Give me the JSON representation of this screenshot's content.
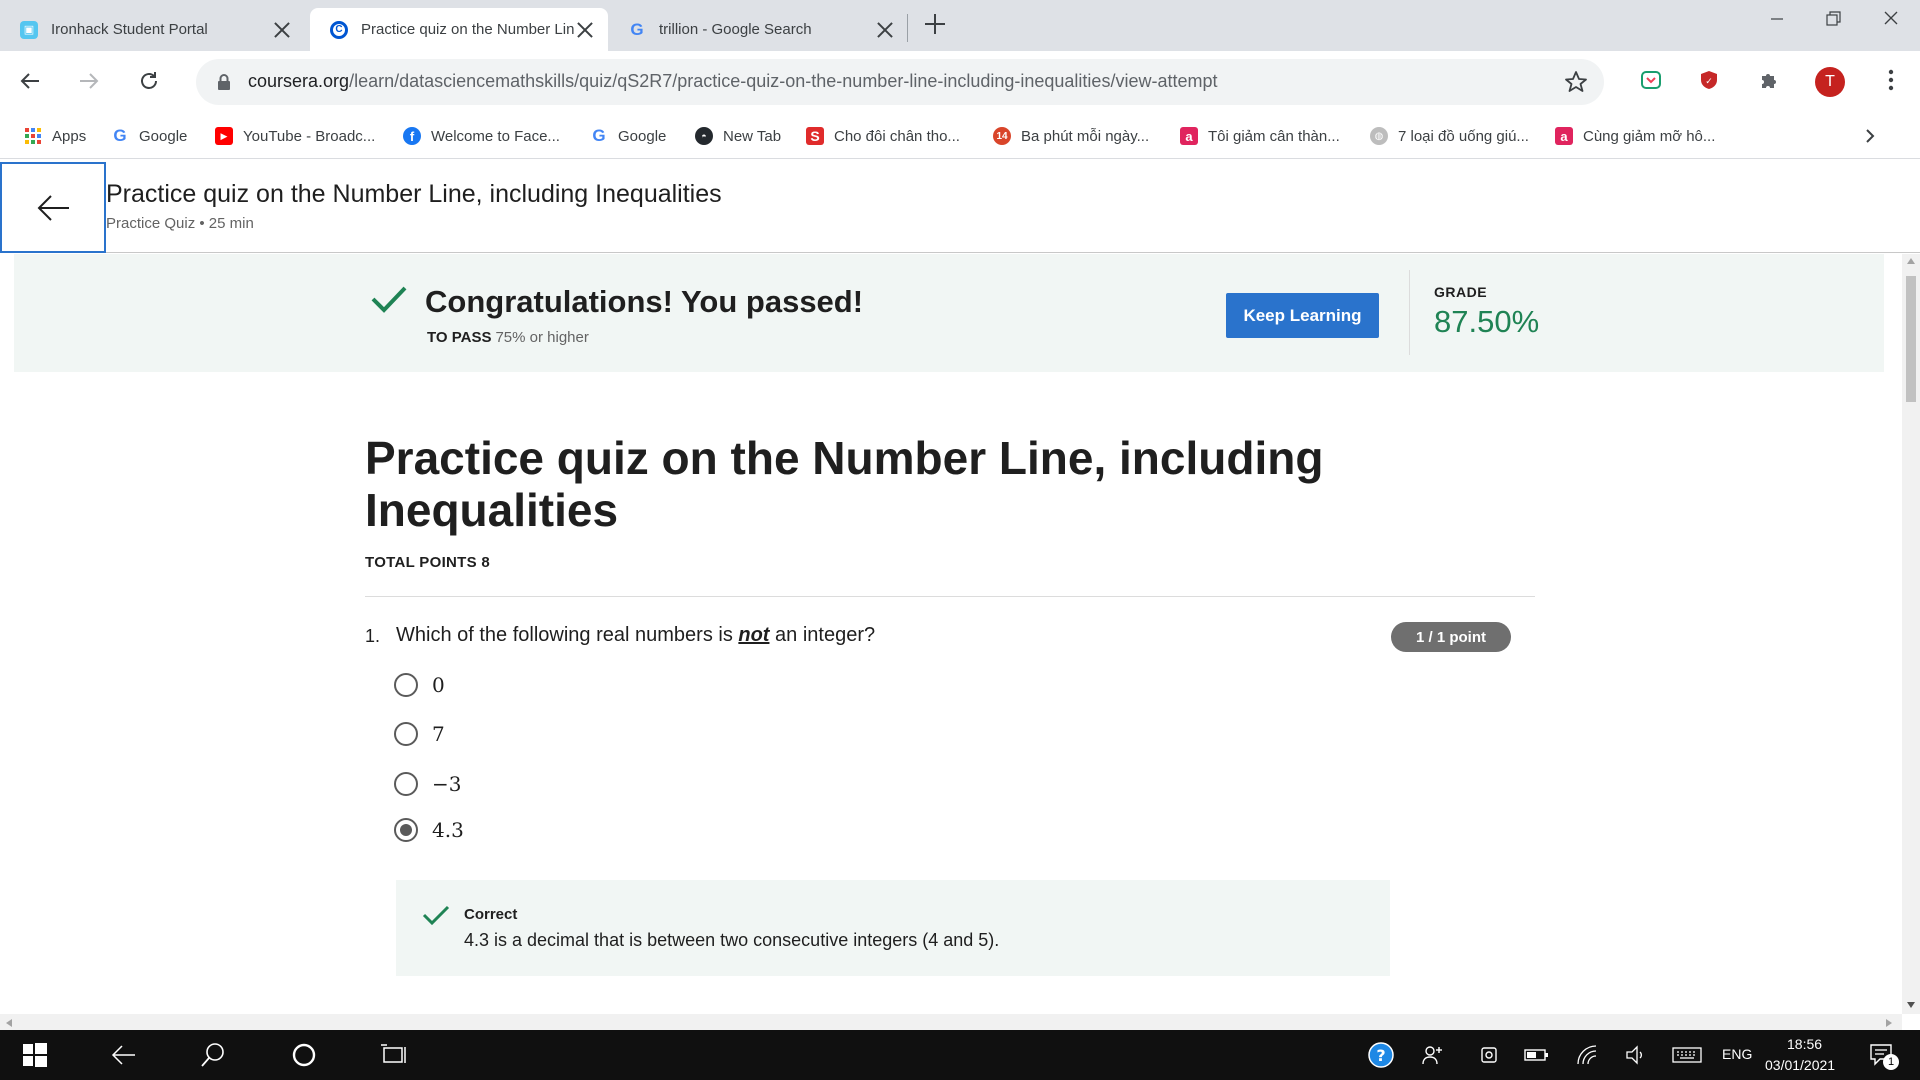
{
  "browser": {
    "tabs": [
      {
        "label": "Ironhack Student Portal",
        "active": false
      },
      {
        "label": "Practice quiz on the Number Line, including Inequalities",
        "active": true
      },
      {
        "label": "trillion - Google Search",
        "active": false
      }
    ],
    "url_host": "coursera.org",
    "url_path": "/learn/datasciencemathskills/quiz/qS2R7/practice-quiz-on-the-number-line-including-inequalities/view-attempt",
    "profile_initial": "T",
    "bookmarks": [
      {
        "label": "Apps",
        "icon": "apps-grid-icon"
      },
      {
        "label": "Google",
        "icon": "google-icon"
      },
      {
        "label": "YouTube - Broadc...",
        "icon": "youtube-icon"
      },
      {
        "label": "Welcome to Face...",
        "icon": "facebook-icon"
      },
      {
        "label": "Google",
        "icon": "google-icon"
      },
      {
        "label": "New Tab",
        "icon": "github-icon"
      },
      {
        "label": "Cho đôi chân thо...",
        "icon": "s-icon"
      },
      {
        "label": "Ba phút mỗi ngày...",
        "icon": "14-icon"
      },
      {
        "label": "Tôi giảm cân thàn...",
        "icon": "a-icon"
      },
      {
        "label": "7 loại đồ uống giú...",
        "icon": "globe-icon"
      },
      {
        "label": "Cùng giảm mỡ hô...",
        "icon": "a-icon"
      }
    ]
  },
  "course_header": {
    "title": "Practice quiz on the Number Line, including Inequalities",
    "subtitle": "Practice Quiz • 25 min"
  },
  "result": {
    "message": "Congratulations! You passed!",
    "to_pass_label": "TO PASS",
    "to_pass_value": "75% or higher",
    "keep_learning": "Keep Learning",
    "grade_label": "GRADE",
    "grade_value": "87.50%"
  },
  "quiz": {
    "title": "Practice quiz on the Number Line, including Inequalities",
    "total_points": "TOTAL POINTS 8",
    "questions": [
      {
        "number": "1.",
        "text_before": "Which of the following real numbers is ",
        "text_emph": "not",
        "text_after": " an integer?",
        "points": "1 / 1 point",
        "options": [
          "0",
          "7",
          "−3",
          "4.3"
        ],
        "selected_index": 3,
        "feedback_label": "Correct",
        "feedback_text": "4.3 is a decimal that is between two consecutive integers (4 and 5)."
      }
    ]
  },
  "taskbar": {
    "lang": "ENG",
    "time": "18:56",
    "date": "03/01/2021",
    "notification_count": "1"
  },
  "colors": {
    "accent_blue": "#2a73cc",
    "success_green": "#1f8354",
    "banner_bg": "#f1f6f4"
  }
}
